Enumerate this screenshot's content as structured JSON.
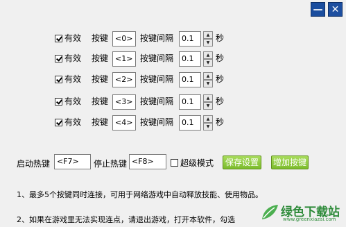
{
  "window": {
    "minimize_label": "—",
    "close_label": "✕"
  },
  "rows": [
    {
      "enabled_label": "有效",
      "key_label": "按键",
      "key_value": "<0>",
      "interval_label": "按键间隔",
      "interval_value": "0.1",
      "unit": "秒"
    },
    {
      "enabled_label": "有效",
      "key_label": "按键",
      "key_value": "<1>",
      "interval_label": "按键间隔",
      "interval_value": "0.1",
      "unit": "秒"
    },
    {
      "enabled_label": "有效",
      "key_label": "按键",
      "key_value": "<2>",
      "interval_label": "按键间隔",
      "interval_value": "0.1",
      "unit": "秒"
    },
    {
      "enabled_label": "有效",
      "key_label": "按键",
      "key_value": "<3>",
      "interval_label": "按键间隔",
      "interval_value": "0.1",
      "unit": "秒"
    },
    {
      "enabled_label": "有效",
      "key_label": "按键",
      "key_value": "<4>",
      "interval_label": "按键间隔",
      "interval_value": "0.1",
      "unit": "秒"
    }
  ],
  "hotkeys": {
    "start_label": "启动热键",
    "start_value": "<F7>",
    "stop_label": "停止热键",
    "stop_value": "<F8>",
    "super_mode_label": "超级模式",
    "save_button": "保存设置",
    "add_button": "增加按键"
  },
  "notes": [
    "1、最多5个按键同时连接，可用于网络游戏中自动释放技能、使用物品。",
    "2、如果在游戏里无法实现连点，请退出游戏，打开本软件，勾选"
  ],
  "watermark": {
    "text": "绿色下载站",
    "url": "www.greenxiazai.com"
  }
}
